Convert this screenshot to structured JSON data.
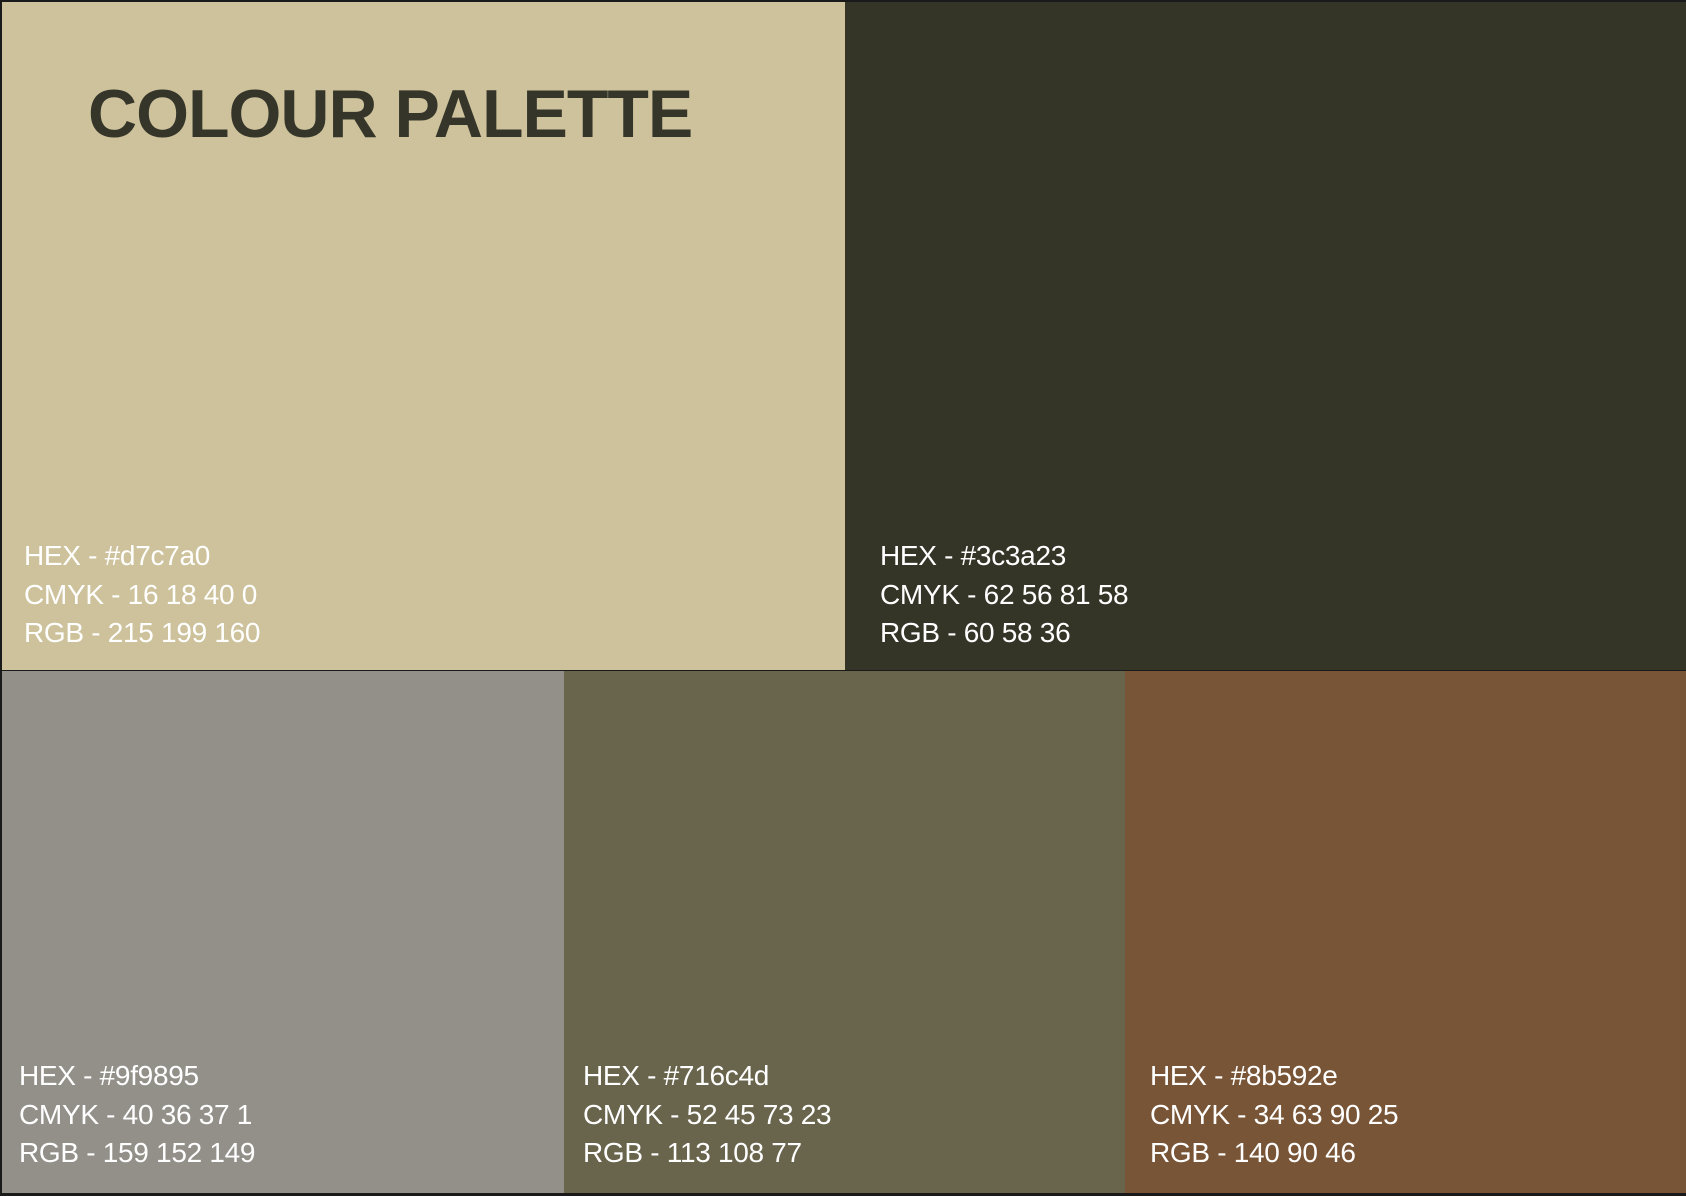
{
  "title": "COLOUR PALETTE",
  "title_color": "#35352a",
  "swatches": [
    {
      "fill": "#cdc29b",
      "hex": "HEX - #d7c7a0",
      "cmyk": "CMYK - 16 18 40 0",
      "rgb": "RGB - 215 199 160"
    },
    {
      "fill": "#343427",
      "hex": "HEX - #3c3a23",
      "cmyk": "CMYK - 62 56 81 58",
      "rgb": "RGB - 60 58 36"
    },
    {
      "fill": "#93908a",
      "hex": "HEX - #9f9895",
      "cmyk": "CMYK - 40 36 37 1",
      "rgb": "RGB - 159 152 149"
    },
    {
      "fill": "#69644c",
      "hex": "HEX - #716c4d",
      "cmyk": "CMYK - 52 45 73 23",
      "rgb": "RGB - 113 108 77"
    },
    {
      "fill": "#795537",
      "hex": "HEX - #8b592e",
      "cmyk": "CMYK - 34 63 90 25",
      "rgb": "RGB - 140 90 46"
    }
  ]
}
